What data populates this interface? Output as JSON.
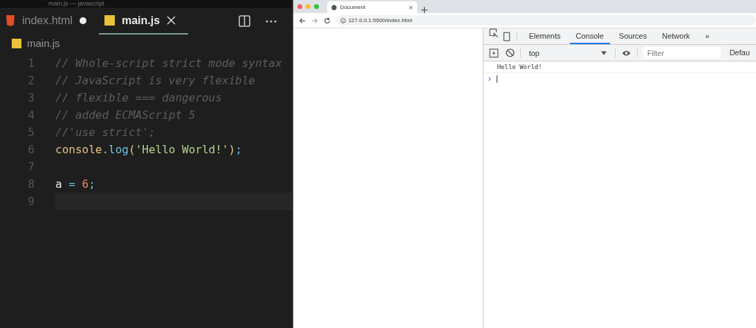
{
  "editor": {
    "title": "main.js — javascript",
    "tabs": [
      {
        "label": "index.html",
        "kind": "html",
        "selected": false,
        "modified": true
      },
      {
        "label": "main.js",
        "kind": "js",
        "selected": true,
        "modified": false
      }
    ],
    "breadcrumb": "main.js",
    "lines": [
      {
        "number": "1",
        "tokens": [
          {
            "kind": "comment",
            "text": "// Whole-script strict mode syntax"
          }
        ]
      },
      {
        "number": "2",
        "tokens": [
          {
            "kind": "comment",
            "text": "// JavaScript is very flexible"
          }
        ]
      },
      {
        "number": "3",
        "tokens": [
          {
            "kind": "comment",
            "text": "// flexible === dangerous"
          }
        ]
      },
      {
        "number": "4",
        "tokens": [
          {
            "kind": "comment",
            "text": "// added ECMAScript 5"
          }
        ]
      },
      {
        "number": "5",
        "tokens": [
          {
            "kind": "comment",
            "text": "//'use strict';"
          }
        ]
      },
      {
        "number": "6",
        "tokens": [
          {
            "kind": "object",
            "text": "console"
          },
          {
            "kind": "punct",
            "text": "."
          },
          {
            "kind": "func",
            "text": "log"
          },
          {
            "kind": "paren",
            "text": "("
          },
          {
            "kind": "string",
            "text": "'Hello World!'"
          },
          {
            "kind": "paren",
            "text": ")"
          },
          {
            "kind": "punct",
            "text": ";"
          }
        ]
      },
      {
        "number": "7"
      },
      {
        "number": "8",
        "tokens": [
          {
            "kind": "var",
            "text": "a"
          },
          {
            "kind": "punct",
            "text": " = "
          },
          {
            "kind": "number",
            "text": "6"
          },
          {
            "kind": "punct",
            "text": ";"
          }
        ]
      },
      {
        "number": "9",
        "current": true
      }
    ]
  },
  "browser": {
    "tab_title": "Document",
    "url": "127.0.0.1:5500/index.html",
    "devtools": {
      "tabs": [
        {
          "label": "Elements",
          "selected": false
        },
        {
          "label": "Console",
          "selected": true
        },
        {
          "label": "Sources",
          "selected": false
        },
        {
          "label": "Network",
          "selected": false
        }
      ],
      "more": "»",
      "context": "top",
      "filter_placeholder": "Filter",
      "levels": "Defau",
      "output": [
        "Hello World!"
      ],
      "prompt": "›"
    }
  }
}
